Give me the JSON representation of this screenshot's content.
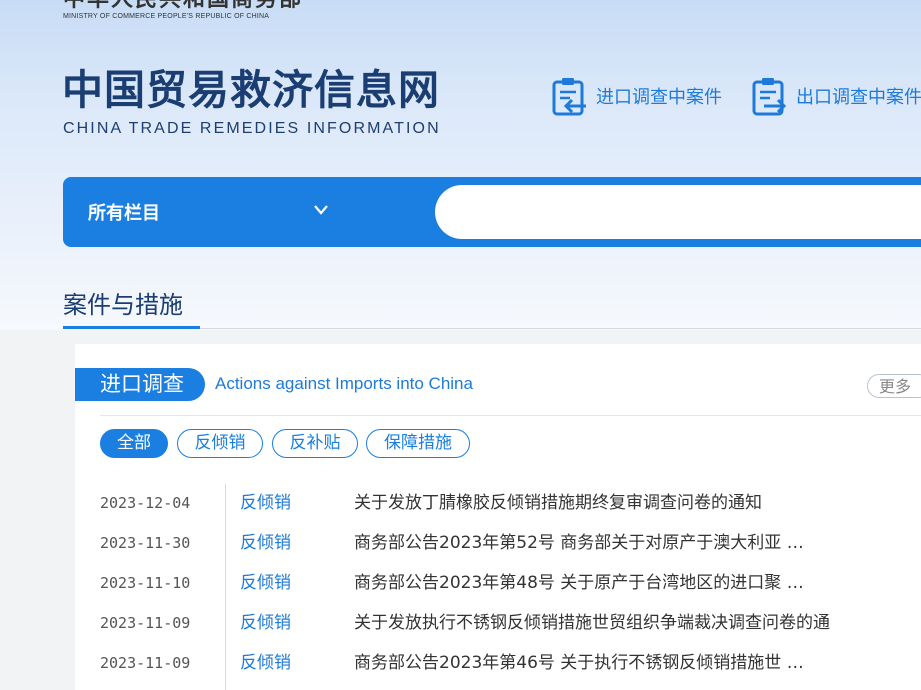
{
  "header": {
    "ministry_cn": "中华人民共和国商务部",
    "ministry_en": "MINISTRY OF COMMERCE PEOPLE'S REPUBLIC OF CHINA",
    "site_title": "中国贸易救济信息网",
    "site_subtitle": "CHINA TRADE REMEDIES INFORMATION",
    "quick_links": [
      {
        "label": "进口调查中案件",
        "icon": "clipboard-import-icon"
      },
      {
        "label": "出口调查中案件",
        "icon": "clipboard-export-icon"
      }
    ]
  },
  "search": {
    "category_label": "所有栏目",
    "placeholder": ""
  },
  "section": {
    "title": "案件与措施"
  },
  "panel": {
    "tag": "进口调查",
    "subtitle": "Actions against Imports into China",
    "more_label": "更多",
    "filters": [
      {
        "label": "全部",
        "active": true
      },
      {
        "label": "反倾销",
        "active": false
      },
      {
        "label": "反补贴",
        "active": false
      },
      {
        "label": "保障措施",
        "active": false
      }
    ],
    "items": [
      {
        "date": "2023-12-04",
        "type": "反倾销",
        "title": "关于发放丁腈橡胶反倾销措施期终复审调查问卷的通知"
      },
      {
        "date": "2023-11-30",
        "type": "反倾销",
        "title": "商务部公告2023年第52号 商务部关于对原产于澳大利亚 …"
      },
      {
        "date": "2023-11-10",
        "type": "反倾销",
        "title": "商务部公告2023年第48号 关于原产于台湾地区的进口聚 …"
      },
      {
        "date": "2023-11-09",
        "type": "反倾销",
        "title": "关于发放执行不锈钢反倾销措施世贸组织争端裁决调查问卷的通"
      },
      {
        "date": "2023-11-09",
        "type": "反倾销",
        "title": "商务部公告2023年第46号 关于执行不锈钢反倾销措施世 …"
      }
    ]
  },
  "colors": {
    "brand_blue": "#1a7fe0",
    "title_navy": "#1a3d72",
    "link_blue": "#1e7ad8"
  }
}
